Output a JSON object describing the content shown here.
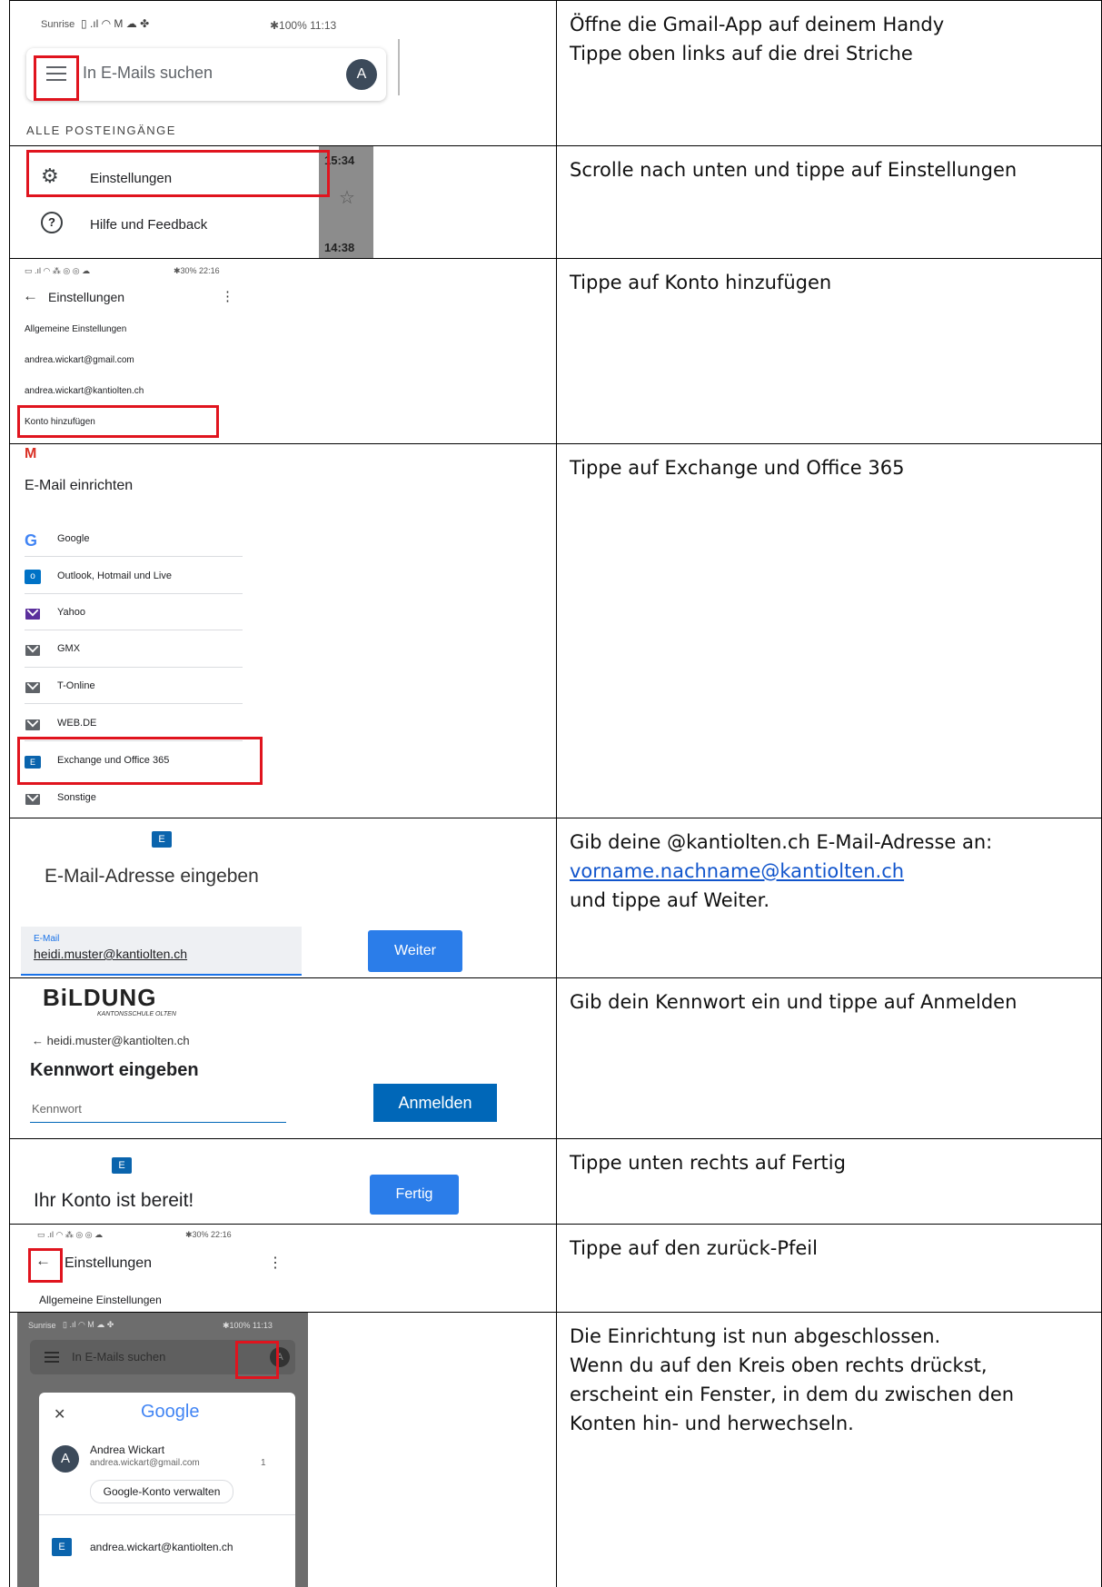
{
  "steps": [
    {
      "instruction": "Öffne die Gmail-App auf deinem Handy\nTippe oben links auf die drei Striche"
    },
    {
      "instruction": "Scrolle nach unten und tippe auf Einstellungen"
    },
    {
      "instruction": "Tippe auf Konto hinzufügen"
    },
    {
      "instruction": "Tippe auf Exchange und Office 365"
    },
    {
      "instruction_pre": "Gib deine @kantiolten.ch E-Mail-Adresse an:",
      "link": "vorname.nachname@kantiolten.ch",
      "instruction_post": "und tippe auf Weiter."
    },
    {
      "instruction": "Gib dein Kennwort ein und tippe auf Anmelden"
    },
    {
      "instruction": "Tippe unten rechts auf Fertig"
    },
    {
      "instruction": "Tippe auf den zurück-Pfeil"
    },
    {
      "instruction": "Die Einrichtung ist nun abgeschlossen.\nWenn du auf den Kreis oben rechts drückst,\nerscheint ein Fenster, in dem du zwischen den\nKonten hin- und herwechseln."
    }
  ],
  "shot1": {
    "carrier": "Sunrise",
    "status_right": "✱100%  11:13",
    "search_placeholder": "In E-Mails suchen",
    "avatar": "A",
    "section": "ALLE POSTEINGÄNGE"
  },
  "shot2": {
    "settings": "Einstellungen",
    "help": "Hilfe und Feedback",
    "time1": "15:34",
    "time2": "14:38"
  },
  "shot3": {
    "status_right": "✱30%  22:16",
    "title": "Einstellungen",
    "items": [
      "Allgemeine Einstellungen",
      "andrea.wickart@gmail.com",
      "andrea.wickart@kantiolten.ch",
      "Konto hinzufügen"
    ]
  },
  "shot4": {
    "title": "E-Mail einrichten",
    "providers": [
      "Google",
      "Outlook, Hotmail und Live",
      "Yahoo",
      "GMX",
      "T-Online",
      "WEB.DE",
      "Exchange und Office 365",
      "Sonstige"
    ]
  },
  "shot5": {
    "title": "E-Mail-Adresse eingeben",
    "field_label": "E-Mail",
    "field_value": "heidi.muster@kantiolten.ch",
    "next": "Weiter"
  },
  "shot6": {
    "logo": "BiLDUNG",
    "logo_sub": "KANTONSSCHULE OLTEN",
    "back_account": "← heidi.muster@kantiolten.ch",
    "heading": "Kennwort eingeben",
    "placeholder": "Kennwort",
    "signin": "Anmelden"
  },
  "shot7": {
    "ready": "Ihr Konto ist bereit!",
    "done": "Fertig"
  },
  "shot8": {
    "status_right": "✱30%  22:16",
    "title": "Einstellungen",
    "item": "Allgemeine Einstellungen"
  },
  "shot9": {
    "carrier": "Sunrise",
    "status_right": "✱100%  11:13",
    "search_placeholder": "In E-Mails suchen",
    "avatar": "A",
    "google": "Google",
    "user_name": "Andrea Wickart",
    "user_email": "andrea.wickart@gmail.com",
    "count": "1",
    "manage": "Google-Konto verwalten",
    "other_account": "andrea.wickart@kantiolten.ch"
  }
}
